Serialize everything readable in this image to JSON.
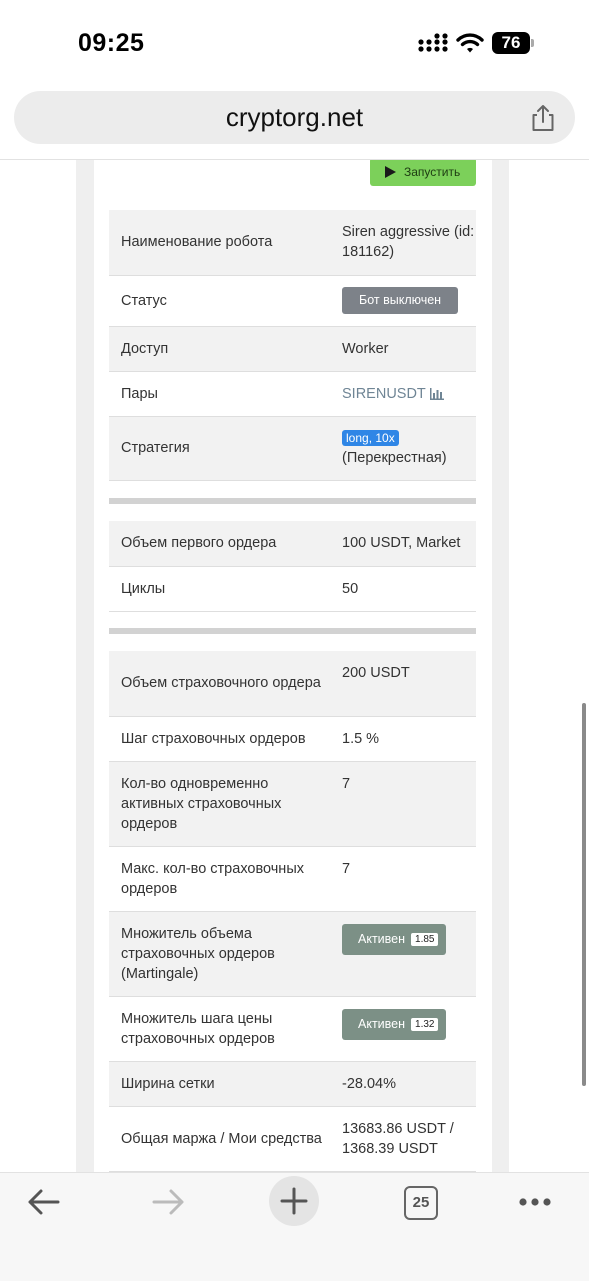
{
  "status_bar": {
    "time": "09:25",
    "battery": "76"
  },
  "browser": {
    "url": "cryptorg.net",
    "tabs_count": "25"
  },
  "run_button": {
    "label": "Запустить"
  },
  "details": {
    "robot_name_label": "Наименование робота",
    "robot_name_value": "Siren aggressive (id: 181162)",
    "status_label": "Статус",
    "status_value": "Бот выключен",
    "access_label": "Доступ",
    "access_value": "Worker",
    "pairs_label": "Пары",
    "pairs_value": "SIRENUSDT",
    "strategy_label": "Стратегия",
    "strategy_tag": "long, 10x",
    "strategy_mode": "(Перекрестная)"
  },
  "order": {
    "first_order_label": "Объем первого ордера",
    "first_order_value": "100 USDT, Market",
    "cycles_label": "Циклы",
    "cycles_value": "50"
  },
  "safety": {
    "volume_label": "Объем страховочного ордера",
    "volume_value": "200 USDT",
    "step_label": "Шаг страховочных ордеров",
    "step_value": "1.5 %",
    "active_count_label": "Кол-во одновременно активных страховочных ордеров",
    "active_count_value": "7",
    "max_count_label": "Макс. кол-во страховочных ордеров",
    "max_count_value": "7",
    "volume_multiplier_label": "Множитель объема страховочных ордеров (Martingale)",
    "volume_multiplier_status": "Активен",
    "volume_multiplier_value": "1.85",
    "step_multiplier_label": "Множитель шага цены страховочных ордеров",
    "step_multiplier_status": "Активен",
    "step_multiplier_value": "1.32",
    "grid_width_label": "Ширина сетки",
    "grid_width_value": "-28.04%",
    "margin_label": "Общая маржа / Мои средства",
    "margin_value": "13683.86 USDT / 1368.39 USDT"
  }
}
